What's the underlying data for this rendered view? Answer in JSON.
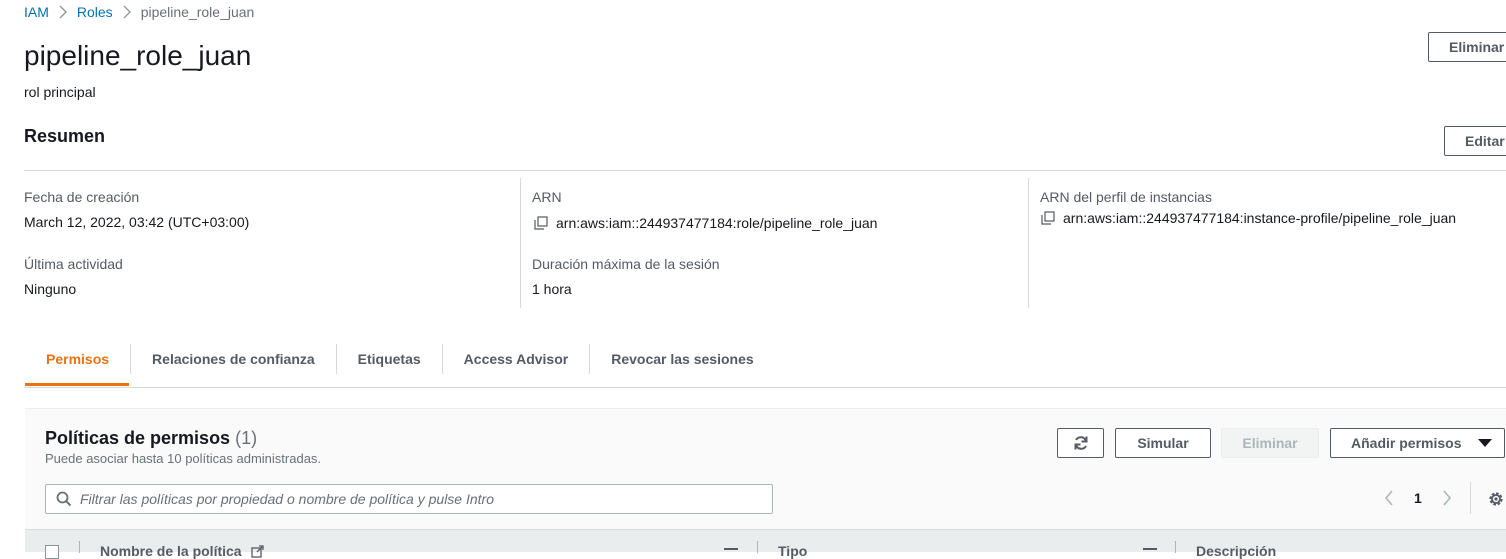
{
  "breadcrumb": {
    "items": [
      "IAM",
      "Roles"
    ],
    "current": "pipeline_role_juan"
  },
  "header": {
    "title": "pipeline_role_juan",
    "subtitle": "rol principal",
    "delete_label": "Eliminar"
  },
  "summary": {
    "title": "Resumen",
    "edit_label": "Editar",
    "created_label": "Fecha de creación",
    "created_value": "March 12, 2022, 03:42 (UTC+03:00)",
    "last_activity_label": "Última actividad",
    "last_activity_value": "Ninguno",
    "arn_label": "ARN",
    "arn_value": "arn:aws:iam::244937477184:role/pipeline_role_juan",
    "max_session_label": "Duración máxima de la sesión",
    "max_session_value": "1 hora",
    "instance_profile_label": "ARN del perfil de instancias",
    "instance_profile_value": "arn:aws:iam::244937477184:instance-profile/pipeline_role_juan"
  },
  "tabs": [
    {
      "label": "Permisos",
      "active": true
    },
    {
      "label": "Relaciones de confianza",
      "active": false
    },
    {
      "label": "Etiquetas",
      "active": false
    },
    {
      "label": "Access Advisor",
      "active": false
    },
    {
      "label": "Revocar las sesiones",
      "active": false
    }
  ],
  "permissions": {
    "title": "Políticas de permisos",
    "count": "(1)",
    "description": "Puede asociar hasta 10 políticas administradas.",
    "simulate_label": "Simular",
    "delete_label": "Eliminar",
    "add_label": "Añadir permisos",
    "search_placeholder": "Filtrar las políticas por propiedad o nombre de política y pulse Intro",
    "page": "1",
    "columns": [
      "Nombre de la política",
      "Tipo",
      "Descripción"
    ]
  },
  "colors": {
    "accent": "#ec7211",
    "link": "#0073bb",
    "border": "#d5dbdb"
  },
  "icons": [
    "chevron-right-icon",
    "copy-icon",
    "refresh-icon",
    "caret-down-icon",
    "search-icon",
    "chevron-left-icon",
    "gear-icon",
    "external-link-icon"
  ]
}
